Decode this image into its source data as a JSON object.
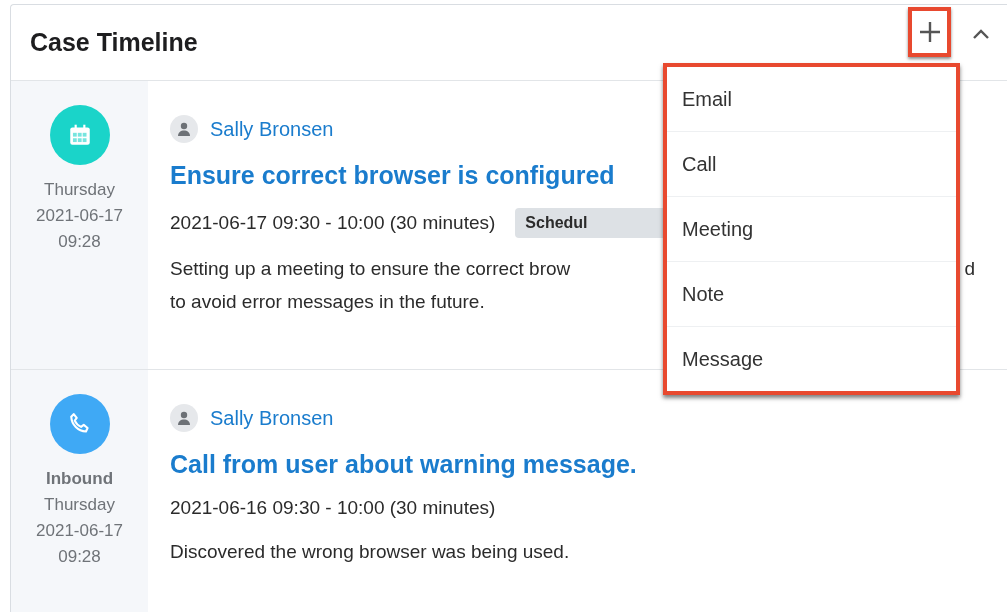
{
  "panel": {
    "title": "Case Timeline",
    "add_button": {
      "highlighted": true
    },
    "collapse_button": {
      "expanded": true
    }
  },
  "entries": [
    {
      "kind": "meeting",
      "weekday": "Thursday",
      "date": "2021-06-17",
      "time": "09:28",
      "author": "Sally Bronsen",
      "subject": "Ensure correct browser is configured",
      "schedule": "2021-06-17 09:30 - 10:00 (30 minutes)",
      "status": "Schedul",
      "description_parts": [
        "Setting up a meeting to ensure the correct brow",
        "d"
      ],
      "description_line_2": "to avoid error messages in the future."
    },
    {
      "kind": "call",
      "direction": "Inbound",
      "weekday": "Thursday",
      "date": "2021-06-17",
      "time": "09:28",
      "author": "Sally Bronsen",
      "subject": "Call from user about warning message.",
      "schedule": "2021-06-16 09:30 - 10:00 (30 minutes)",
      "description_parts": [
        "Discovered the wrong browser was being used."
      ]
    }
  ],
  "add_menu": {
    "open": true,
    "highlighted": true,
    "items": [
      "Email",
      "Call",
      "Meeting",
      "Note",
      "Message"
    ]
  }
}
